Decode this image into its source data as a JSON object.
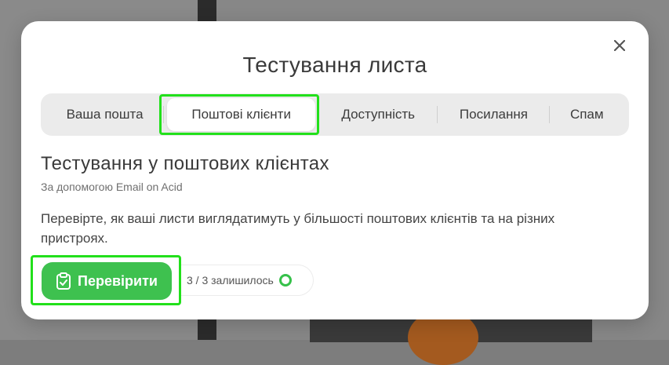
{
  "modal": {
    "title": "Тестування листа"
  },
  "tabs": [
    {
      "label": "Ваша пошта",
      "active": false
    },
    {
      "label": "Поштові клієнти",
      "active": true
    },
    {
      "label": "Доступність",
      "active": false
    },
    {
      "label": "Посилання",
      "active": false
    },
    {
      "label": "Спам",
      "active": false
    }
  ],
  "section": {
    "title": "Тестування у поштових клієнтах",
    "subtitle": "За допомогою Email on Acid",
    "description": "Перевірте, як ваші листи виглядатимуть у більшості поштових клієнтів та на різних пристроях."
  },
  "action": {
    "check_label": "Перевірити",
    "icon": "clipboard-check-icon",
    "quota_text": "3 / 3 залишилось"
  },
  "icons": {
    "close": "close-icon",
    "quota": "progress-ring-icon"
  },
  "colors": {
    "accent": "#3ec14f",
    "highlight": "#22e01b"
  }
}
